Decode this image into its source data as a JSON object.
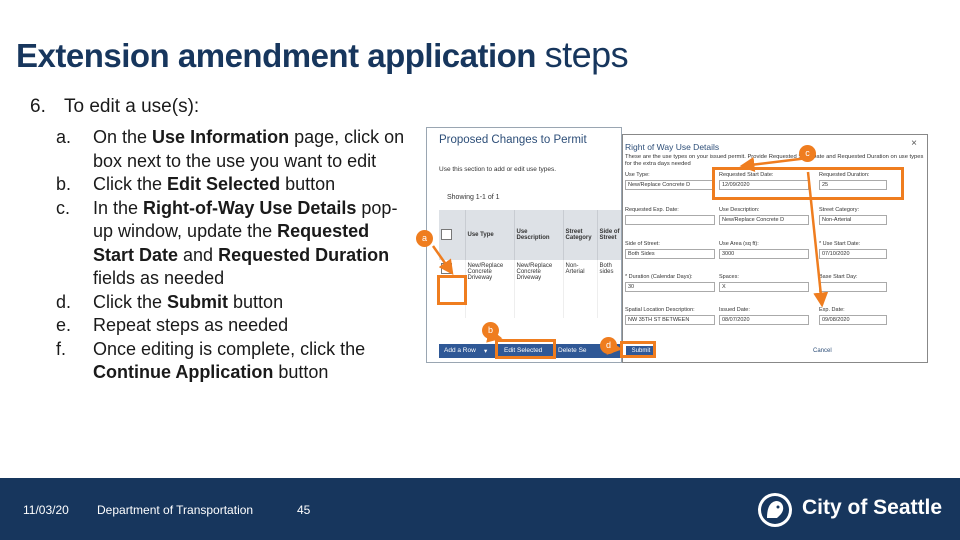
{
  "title": {
    "part1": "Extension amendment application",
    "part2": "steps"
  },
  "step": {
    "number": "6.",
    "text": "To edit a use(s):"
  },
  "sub_steps": [
    {
      "letter": "a.",
      "pre": "On the ",
      "bold": "Use Information",
      "post": " page, click on box next to the use you want to edit"
    },
    {
      "letter": "b.",
      "pre": "Click the ",
      "bold": "Edit Selected",
      "post": " button"
    },
    {
      "letter": "c.",
      "pre": "In the ",
      "bold": "Right-of-Way Use Details",
      "post": " pop-up window, update the ",
      "bold2": "Requested Start Date",
      "mid2": " and ",
      "bold3": "Requested Duration",
      "post2": " fields as needed"
    },
    {
      "letter": "d.",
      "pre": "Click the ",
      "bold": "Submit",
      "post": " button"
    },
    {
      "letter": "e.",
      "pre": "Repeat steps as needed"
    },
    {
      "letter": "f.",
      "pre": "Once editing is complete, click the ",
      "bold": "Continue Application",
      "post": " button"
    }
  ],
  "screenshot": {
    "title": "Proposed Changes to Permit",
    "description": "Use this section to add or edit use types.",
    "showing": "Showing 1-1 of 1",
    "columns": [
      "Use Type",
      "Use Description",
      "Street Category",
      "Side of Street"
    ],
    "row": [
      "New/Replace Concrete Driveway",
      "New/Replace Concrete Driveway",
      "Non-Arterial",
      "Both sides"
    ],
    "buttons": {
      "add_row": "Add a Row",
      "edit_selected": "Edit Selected",
      "delete": "Delete Se"
    }
  },
  "popup": {
    "title": "Right of Way Use Details",
    "close": "×",
    "description": "These are the use types on your issued permit. Provide Requested Start Date and Requested Duration on use types for the extra days needed",
    "fields": [
      {
        "label": "Use Type:",
        "value": "New/Replace Concrete D"
      },
      {
        "label": "Requested Start Date:",
        "value": "12/09/2020"
      },
      {
        "label": "Requested Duration:",
        "value": "25"
      },
      {
        "label": "Requested Exp. Date:",
        "value": ""
      },
      {
        "label": "Use Description:",
        "value": "New/Replace Concrete D"
      },
      {
        "label": "Street Category:",
        "value": "Non-Arterial"
      },
      {
        "label": "Side of Street:",
        "value": "Both Sides"
      },
      {
        "label": "Use Area (sq ft):",
        "value": "3000"
      },
      {
        "label": "* Use Start Date:",
        "value": "07/10/2020"
      },
      {
        "label": "* Duration (Calendar Days):",
        "value": "30"
      },
      {
        "label": "Spaces:",
        "value": "X"
      },
      {
        "label": "Base Start Day:",
        "value": ""
      },
      {
        "label": "Spatial Location Description:",
        "value": "NW 35TH ST BETWEEN"
      },
      {
        "label": "Issued Date:",
        "value": "08/07/2020"
      },
      {
        "label": "Exp. Date:",
        "value": "09/08/2020"
      }
    ],
    "submit": "Submit",
    "cancel": "Cancel"
  },
  "badges": {
    "a": "a",
    "b": "b",
    "c": "c",
    "d": "d"
  },
  "colors": {
    "navy": "#17365d",
    "accent": "#ef7d1f",
    "button_blue": "#2f5896"
  },
  "footer": {
    "date": "11/03/20",
    "department": "Department of Transportation",
    "page": "45",
    "city": "City of Seattle"
  }
}
